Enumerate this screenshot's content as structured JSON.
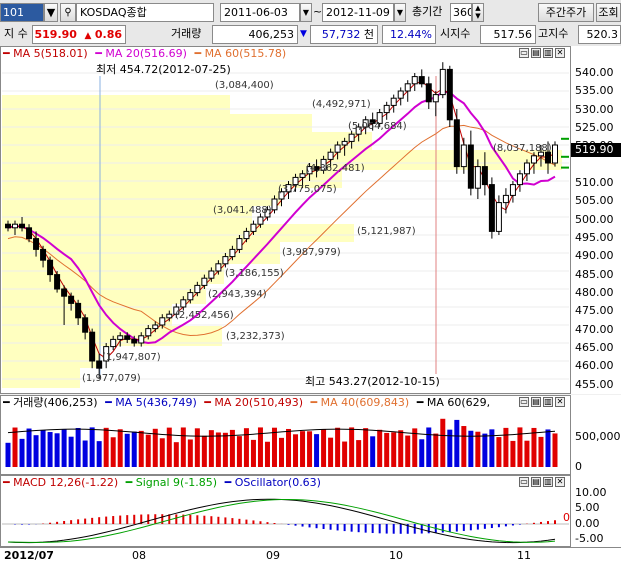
{
  "toolbar": {
    "code": "101",
    "search_icon": "magnifier-icon",
    "market_name": "KOSDAQ종합",
    "date_from": "2011-06-03",
    "date_to": "2012-11-09",
    "period_label": "총기간",
    "period_value": "360",
    "period_button": "주간주가",
    "query_button": "조회"
  },
  "quote": {
    "index_label": "지 수",
    "price": "519.90",
    "change": "0.86",
    "volume_label": "거래량",
    "volume": "406,253",
    "amount": "57,732",
    "amount_unit": "천",
    "pct": "12.44%",
    "open_label": "시지수",
    "open_value": "517.56",
    "high_label": "고지수",
    "high_value": "520.3"
  },
  "price_panel": {
    "ma5": "MA 5(518.01)",
    "ma20": "MA 20(516.69)",
    "ma60": "MA 60(515.78)",
    "low_note": "최저 454.72(2012-07-25)",
    "high_note": "최고 543.27(2012-10-15)",
    "last_price": "519.90",
    "y_ticks": [
      "540.00",
      "535.00",
      "530.00",
      "525.00",
      "520.00",
      "515.00",
      "510.00",
      "505.00",
      "500.00",
      "495.00",
      "490.00",
      "485.00",
      "480.00",
      "475.00",
      "470.00",
      "465.00",
      "460.00",
      "455.00"
    ],
    "volume_profile": [
      "(3,084,400)",
      "(4,492,971)",
      "(5,064,684)",
      "(8,037,188)",
      "(4,362,481)",
      "(3,775,075)",
      "(3,041,488)",
      "(5,121,987)",
      "(3,987,979)",
      "(3,186,155)",
      "(2,943,394)",
      "(2,452,456)",
      "(3,232,373)",
      "(1,947,807)",
      "(1,977,079)"
    ]
  },
  "volume_panel": {
    "title": "거래량(406,253)",
    "ma5": "MA 5(436,749)",
    "ma20": "MA 20(510,493)",
    "ma40": "MA 40(609,843)",
    "ma60": "MA 60(629,",
    "y_ticks": [
      "500,000",
      "0"
    ]
  },
  "macd_panel": {
    "macd": "MACD 12,26(-1.22)",
    "signal": "Signal 9(-1.85)",
    "osc": "OScillator(0.63)",
    "y_ticks": [
      "10.00",
      "5.00",
      "0.00",
      "-5.00"
    ],
    "zero": "0"
  },
  "x_axis": [
    "2012/07",
    "08",
    "09",
    "10",
    "11"
  ],
  "colors": {
    "up": "#e00000",
    "down": "#0000e0",
    "ma20": "#d000d0",
    "ma5": "#c00000",
    "ma60": "#e07030",
    "signal": "#00a000",
    "band": "#ffffc0"
  },
  "chart_data": {
    "type": "candlestick",
    "price_range": [
      455,
      540
    ],
    "candles": [
      [
        498,
        499,
        496,
        497
      ],
      [
        497,
        499,
        495,
        498
      ],
      [
        498,
        500,
        496,
        497
      ],
      [
        497,
        498,
        493,
        494
      ],
      [
        494,
        496,
        489,
        491
      ],
      [
        491,
        492,
        486,
        488
      ],
      [
        488,
        489,
        482,
        484
      ],
      [
        484,
        485,
        479,
        480
      ],
      [
        480,
        481,
        470,
        478
      ],
      [
        478,
        479,
        474,
        476
      ],
      [
        476,
        477,
        470,
        472
      ],
      [
        472,
        473,
        466,
        468
      ],
      [
        468,
        469,
        458,
        460
      ],
      [
        460,
        462,
        455,
        458
      ],
      [
        460,
        465,
        458,
        464
      ],
      [
        464,
        467,
        463,
        466
      ],
      [
        466,
        468,
        464,
        467
      ],
      [
        467,
        468,
        465,
        466
      ],
      [
        466,
        467,
        464,
        465
      ],
      [
        465,
        468,
        464,
        467
      ],
      [
        467,
        470,
        466,
        469
      ],
      [
        469,
        471,
        468,
        470
      ],
      [
        470,
        473,
        469,
        472
      ],
      [
        472,
        474,
        471,
        473
      ],
      [
        473,
        476,
        472,
        475
      ],
      [
        475,
        478,
        474,
        477
      ],
      [
        477,
        480,
        476,
        479
      ],
      [
        479,
        482,
        478,
        481
      ],
      [
        481,
        484,
        480,
        483
      ],
      [
        483,
        486,
        482,
        485
      ],
      [
        485,
        488,
        484,
        487
      ],
      [
        487,
        490,
        486,
        489
      ],
      [
        489,
        492,
        488,
        491
      ],
      [
        491,
        495,
        490,
        494
      ],
      [
        494,
        497,
        493,
        496
      ],
      [
        496,
        499,
        495,
        498
      ],
      [
        498,
        501,
        497,
        500
      ],
      [
        500,
        503,
        499,
        502
      ],
      [
        502,
        506,
        501,
        505
      ],
      [
        505,
        508,
        503,
        507
      ],
      [
        507,
        510,
        505,
        509
      ],
      [
        509,
        512,
        507,
        511
      ],
      [
        511,
        513,
        508,
        512
      ],
      [
        512,
        515,
        510,
        514
      ],
      [
        514,
        516,
        511,
        513
      ],
      [
        513,
        517,
        512,
        516
      ],
      [
        516,
        519,
        514,
        518
      ],
      [
        518,
        521,
        516,
        520
      ],
      [
        520,
        522,
        517,
        521
      ],
      [
        521,
        524,
        519,
        523
      ],
      [
        523,
        526,
        521,
        525
      ],
      [
        525,
        528,
        523,
        527
      ],
      [
        527,
        529,
        524,
        526
      ],
      [
        526,
        530,
        525,
        529
      ],
      [
        529,
        532,
        527,
        531
      ],
      [
        531,
        534,
        529,
        533
      ],
      [
        533,
        536,
        531,
        535
      ],
      [
        535,
        538,
        532,
        537
      ],
      [
        537,
        540,
        535,
        539
      ],
      [
        539,
        541,
        536,
        537
      ],
      [
        537,
        539,
        530,
        532
      ],
      [
        532,
        535,
        528,
        534
      ],
      [
        534,
        543,
        533,
        541
      ],
      [
        541,
        542,
        525,
        527
      ],
      [
        527,
        530,
        512,
        514
      ],
      [
        514,
        522,
        512,
        520
      ],
      [
        520,
        524,
        506,
        508
      ],
      [
        508,
        516,
        505,
        514
      ],
      [
        514,
        518,
        506,
        509
      ],
      [
        509,
        511,
        494,
        496
      ],
      [
        496,
        506,
        495,
        504
      ],
      [
        504,
        508,
        501,
        506
      ],
      [
        506,
        510,
        504,
        509
      ],
      [
        509,
        513,
        507,
        512
      ],
      [
        512,
        516,
        510,
        515
      ],
      [
        515,
        518,
        512,
        517
      ],
      [
        517,
        520,
        514,
        518
      ],
      [
        518,
        521,
        512,
        515
      ],
      [
        515,
        521,
        514,
        520
      ]
    ]
  }
}
